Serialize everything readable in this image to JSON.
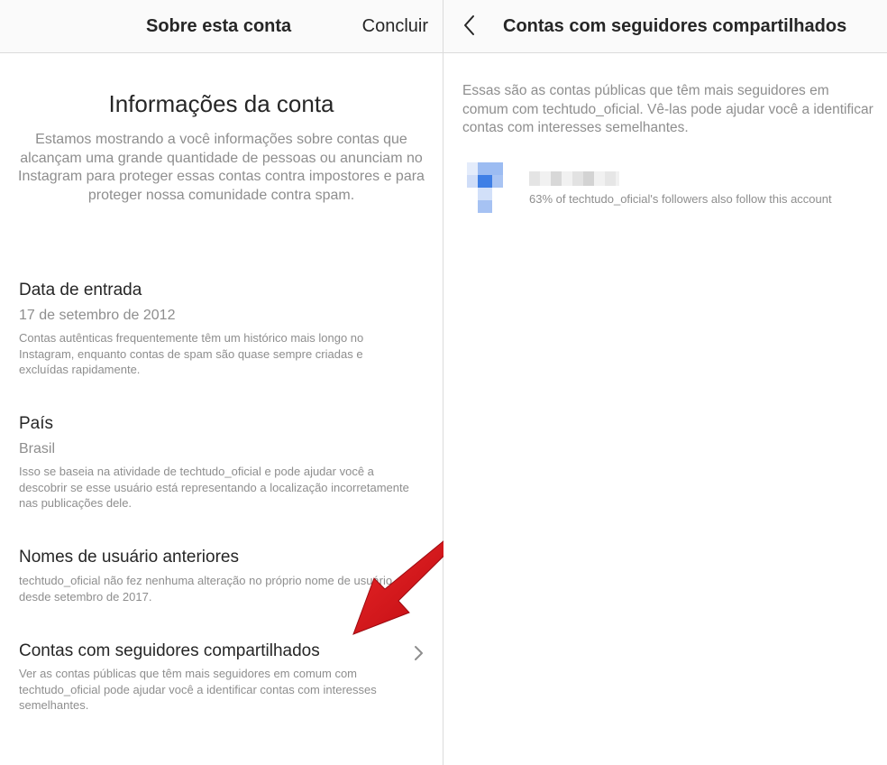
{
  "left": {
    "nav": {
      "title": "Sobre esta conta",
      "done_label": "Concluir"
    },
    "heading": "Informações da conta",
    "intro": "Estamos mostrando a você informações sobre contas que alcançam uma grande quantidade de pessoas ou anunciam no Instagram para proteger essas contas contra impostores e para proteger nossa comunidade contra spam.",
    "date_joined": {
      "title": "Data de entrada",
      "value": "17 de setembro de 2012",
      "description": "Contas autênticas frequentemente têm um histórico mais longo no Instagram, enquanto contas de spam são quase sempre criadas e excluídas rapidamente."
    },
    "country": {
      "title": "País",
      "value": "Brasil",
      "description": "Isso se baseia na atividade de techtudo_oficial e pode ajudar você a descobrir se esse usuário está representando a localização incorretamente nas publicações dele."
    },
    "previous_usernames": {
      "title": "Nomes de usuário anteriores",
      "description": "techtudo_oficial não fez nenhuma alteração no próprio nome de usuário desde setembro de 2017."
    },
    "shared_followers": {
      "title": "Contas com seguidores compartilhados",
      "description": "Ver as contas públicas que têm mais seguidores em comum com techtudo_oficial pode ajudar você a identificar contas com interesses semelhantes."
    }
  },
  "right": {
    "nav": {
      "title": "Contas com seguidores compartilhados"
    },
    "description": "Essas são as contas públicas que têm mais seguidores em comum com techtudo_oficial. Vê-las pode ajudar você a identificar contas com interesses semelhantes.",
    "accounts": [
      {
        "stat": "63% of techtudo_oficial's followers also follow this account"
      }
    ]
  },
  "colors": {
    "text_primary": "#262626",
    "text_secondary": "#8e8e8e",
    "divider": "#dbdbdb",
    "nav_background": "#fafafa",
    "annotation_arrow": "#d4101a"
  },
  "icons": {
    "back": "chevron-left-icon",
    "row_chevron": "chevron-right-icon",
    "annotation": "red-arrow-icon"
  }
}
